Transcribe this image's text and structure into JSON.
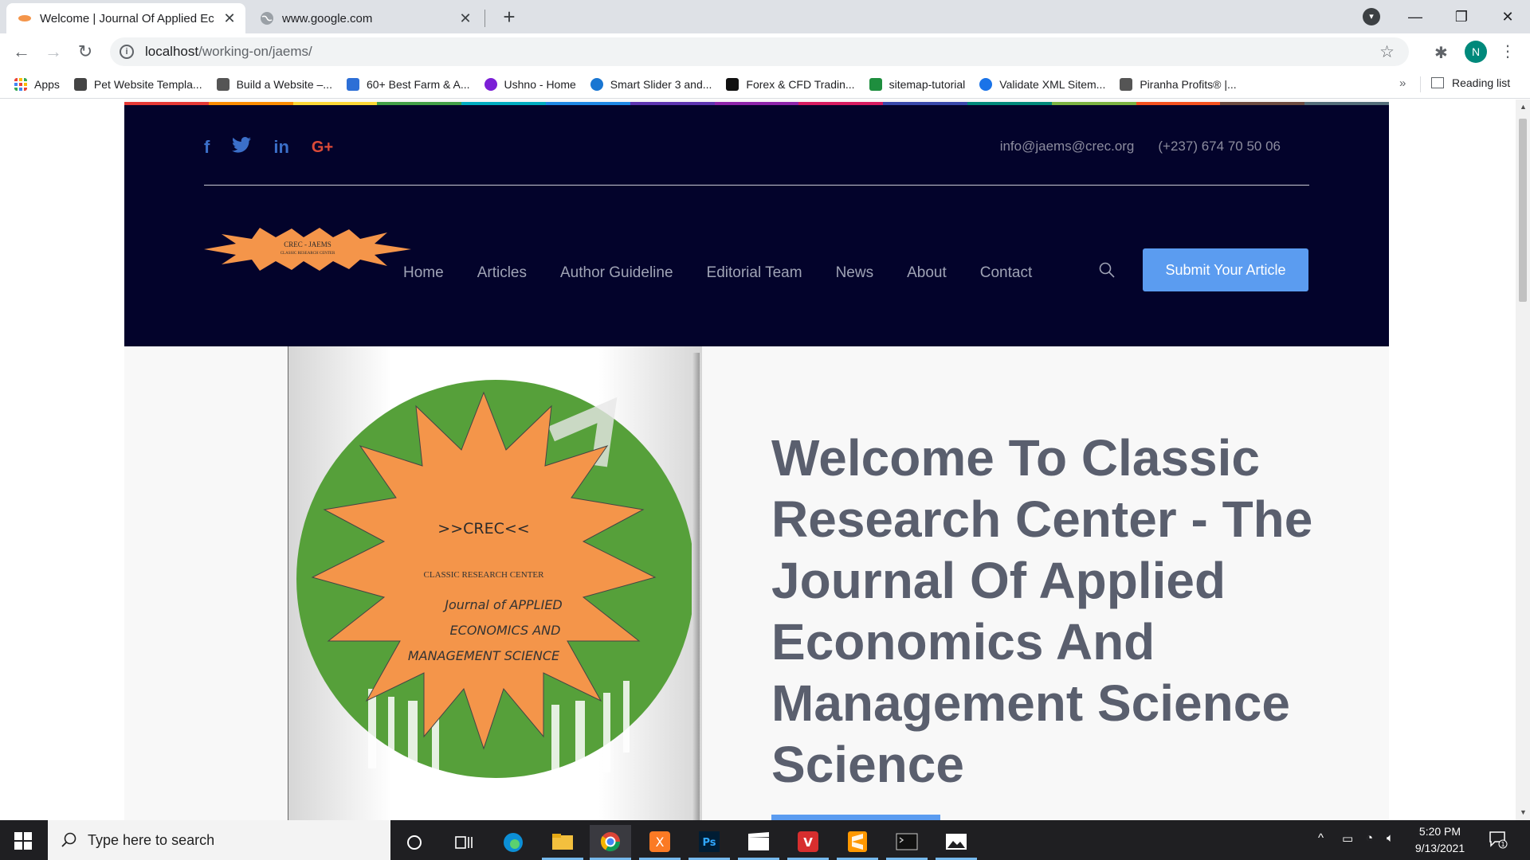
{
  "browser": {
    "tabs": [
      {
        "title": "Welcome | Journal Of Applied Ec",
        "active": true
      },
      {
        "title": "www.google.com",
        "active": false
      }
    ],
    "url_host": "localhost",
    "url_path": "/working-on/jaems/",
    "profile_initial": "N",
    "bookmarks": [
      {
        "label": "Apps",
        "icon_color": "#ea4335"
      },
      {
        "label": "Pet Website Templa...",
        "icon_color": "#444444"
      },
      {
        "label": "Build a Website –...",
        "icon_color": "#555555"
      },
      {
        "label": "60+ Best Farm & A...",
        "icon_color": "#2d6fd6"
      },
      {
        "label": "Ushno - Home",
        "icon_color": "#7b1fd6"
      },
      {
        "label": "Smart Slider 3 and...",
        "icon_color": "#1976d2"
      },
      {
        "label": "Forex & CFD Tradin...",
        "icon_color": "#111111"
      },
      {
        "label": "sitemap-tutorial",
        "icon_color": "#1e8e3e"
      },
      {
        "label": "Validate XML Sitem...",
        "icon_color": "#1a73e8"
      },
      {
        "label": "Piranha Profits® |...",
        "icon_color": "#555555"
      }
    ],
    "bookmarks_more": "»",
    "reading_list": "Reading list"
  },
  "site": {
    "social": [
      "f",
      "t",
      "in",
      "G+"
    ],
    "email": "info@jaems@crec.org",
    "phone": "(+237) 674 70 50 06",
    "logo_line1": "CREC - JAEMS",
    "logo_line2": "CLASSIC RESEARCH CENTER",
    "nav": [
      "Home",
      "Articles",
      "Author Guideline",
      "Editorial Team",
      "News",
      "About",
      "Contact"
    ],
    "submit_label": "Submit Your Article",
    "hero_badge": {
      "line1": ">>CREC<<",
      "line2": "CLASSIC RESEARCH CENTER",
      "line3": "Journal of APPLIED",
      "line4": "ECONOMICS AND",
      "line5": "MANAGEMENT SCIENCE"
    },
    "hero_title": "Welcome To Classic Research Center - The Journal Of Applied Economics And Management Science Science",
    "colorbar": [
      "#e53935",
      "#fb8c00",
      "#fdd835",
      "#43a047",
      "#00acc1",
      "#1e88e5",
      "#5e35b1",
      "#8e24aa",
      "#d81b60",
      "#3949ab",
      "#00897b",
      "#7cb342",
      "#f4511e",
      "#6d4c41",
      "#546e7a"
    ],
    "colors": {
      "header_bg": "#03032b",
      "accent": "#5b9cf0",
      "badge_orange": "#f4954a",
      "badge_green": "#56a03a"
    }
  },
  "taskbar": {
    "search_placeholder": "Type here to search",
    "time": "5:20 PM",
    "date": "9/13/2021",
    "notification_count": "1"
  }
}
